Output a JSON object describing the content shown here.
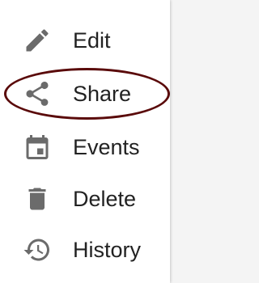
{
  "menu": {
    "items": [
      {
        "key": "edit",
        "label": "Edit",
        "icon": "pencil-icon"
      },
      {
        "key": "share",
        "label": "Share",
        "icon": "share-icon"
      },
      {
        "key": "events",
        "label": "Events",
        "icon": "calendar-icon"
      },
      {
        "key": "delete",
        "label": "Delete",
        "icon": "trash-icon"
      },
      {
        "key": "history",
        "label": "History",
        "icon": "history-icon"
      }
    ]
  },
  "colors": {
    "icon": "#6b6b6b",
    "label": "#222222",
    "highlight": "#5a0a0a"
  }
}
